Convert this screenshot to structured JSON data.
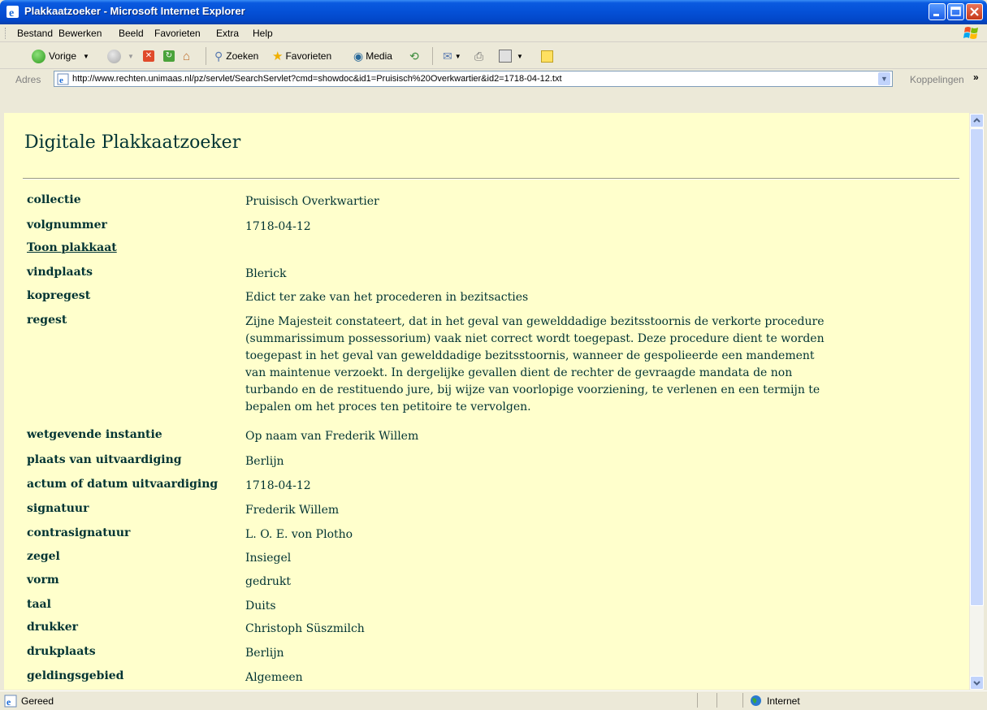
{
  "window": {
    "title": "Plakkaatzoeker - Microsoft Internet Explorer"
  },
  "menu": [
    "Bestand",
    "Bewerken",
    "Beeld",
    "Favorieten",
    "Extra",
    "Help"
  ],
  "toolbar": {
    "back_label": "Vorige",
    "search_label": "Zoeken",
    "favorites_label": "Favorieten",
    "media_label": "Media"
  },
  "address": {
    "label": "Adres",
    "url": "http://www.rechten.unimaas.nl/pz/servlet/SearchServlet?cmd=showdoc&id1=Pruisisch%20Overkwartier&id2=1718-04-12.txt",
    "links_label": "Koppelingen"
  },
  "page": {
    "title": "Digitale Plakkaatzoeker",
    "show_link": "Toon plakkaat",
    "fields": [
      {
        "label": "collectie",
        "value": "Pruisisch Overkwartier"
      },
      {
        "label": "volgnummer",
        "value": "1718-04-12"
      },
      {
        "label": "vindplaats",
        "value": "Blerick"
      },
      {
        "label": "kopregest",
        "value": "Edict ter zake van het procederen in bezitsacties"
      },
      {
        "label": "regest",
        "value": "Zijne Majesteit constateert, dat in het geval van gewelddadige bezitsstoornis de verkorte procedure (summarissimum possessorium) vaak niet correct wordt toegepast. Deze procedure dient te worden toegepast in het geval van gewelddadige bezitsstoornis, wanneer de gespolieerde een mandement van maintenue verzoekt. In dergelijke gevallen dient de rechter de gevraagde mandata de non turbando en de restituendo jure, bij wijze van voorlopige voorziening, te verlenen en een termijn te bepalen om het proces ten petitoire te vervolgen."
      },
      {
        "label": "wetgevende instantie",
        "value": "Op naam van Frederik Willem"
      },
      {
        "label": "plaats van uitvaardiging",
        "value": "Berlijn"
      },
      {
        "label": "actum of datum uitvaardiging",
        "value": "1718-04-12"
      },
      {
        "label": "signatuur",
        "value": "Frederik Willem"
      },
      {
        "label": "contrasignatuur",
        "value": "L. O. E. von Plotho"
      },
      {
        "label": "zegel",
        "value": "Insiegel"
      },
      {
        "label": "vorm",
        "value": "gedrukt"
      },
      {
        "label": "taal",
        "value": "Duits"
      },
      {
        "label": "drukker",
        "value": "Christoph Süszmilch"
      },
      {
        "label": "drukplaats",
        "value": "Berlijn"
      },
      {
        "label": "geldingsgebied",
        "value": "Algemeen"
      }
    ]
  },
  "status": {
    "text": "Gereed",
    "zone": "Internet"
  },
  "colors": {
    "page_bg": "#ffffcc",
    "text": "#003333",
    "link": "#006666",
    "titlebar": "#0450d6"
  }
}
